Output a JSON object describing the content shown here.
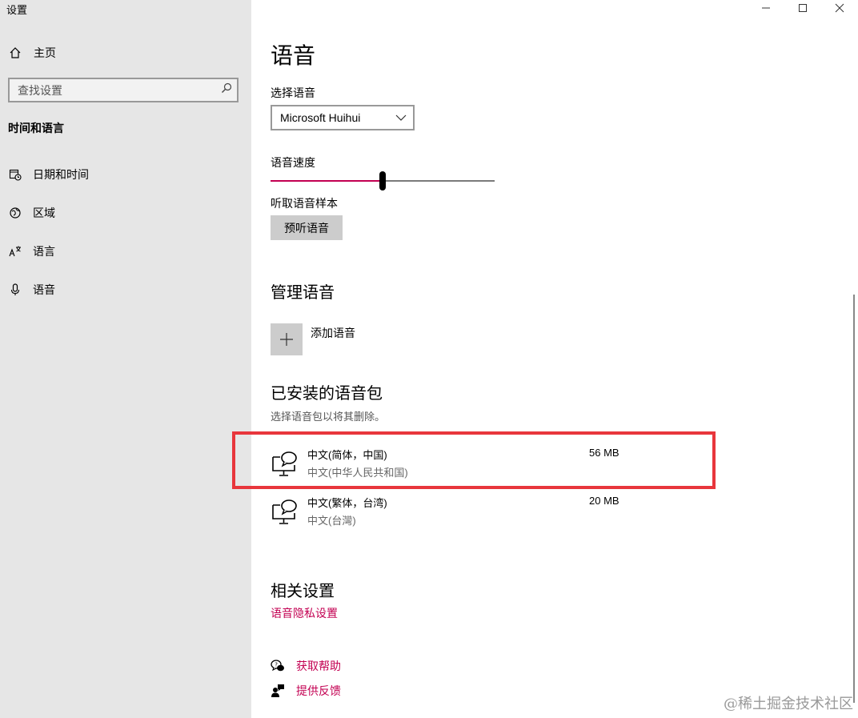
{
  "app": {
    "title": "设置"
  },
  "sidebar": {
    "home_label": "主页",
    "search_placeholder": "查找设置",
    "section_title": "时间和语言",
    "items": [
      {
        "label": "日期和时间",
        "icon": "date-time-icon"
      },
      {
        "label": "区域",
        "icon": "globe-region-icon"
      },
      {
        "label": "语言",
        "icon": "language-icon"
      },
      {
        "label": "语音",
        "icon": "microphone-icon"
      }
    ]
  },
  "main": {
    "title": "语音",
    "select_voice_label": "选择语音",
    "voice_selected": "Microsoft Huihui",
    "speed_label": "语音速度",
    "speed_fraction": 0.5,
    "sample_label": "听取语音样本",
    "preview_button": "预听语音",
    "manage_heading": "管理语音",
    "add_voice_label": "添加语音",
    "installed_heading": "已安装的语音包",
    "installed_hint": "选择语音包以将其删除。",
    "packs": [
      {
        "name": "中文(简体，中国)",
        "sub": "中文(中华人民共和国)",
        "size": "56 MB",
        "icon": "speech-computer-icon"
      },
      {
        "name": "中文(繁体，台湾)",
        "sub": "中文(台灣)",
        "size": "20 MB",
        "icon": "speech-computer-icon"
      }
    ],
    "related_heading": "相关设置",
    "privacy_link": "语音隐私设置",
    "help_label": "获取帮助",
    "feedback_label": "提供反馈"
  },
  "colors": {
    "accent": "#c30052",
    "highlight_box": "#e8363c",
    "sidebar_bg": "#e6e6e6"
  },
  "watermark": "@稀土掘金技术社区"
}
